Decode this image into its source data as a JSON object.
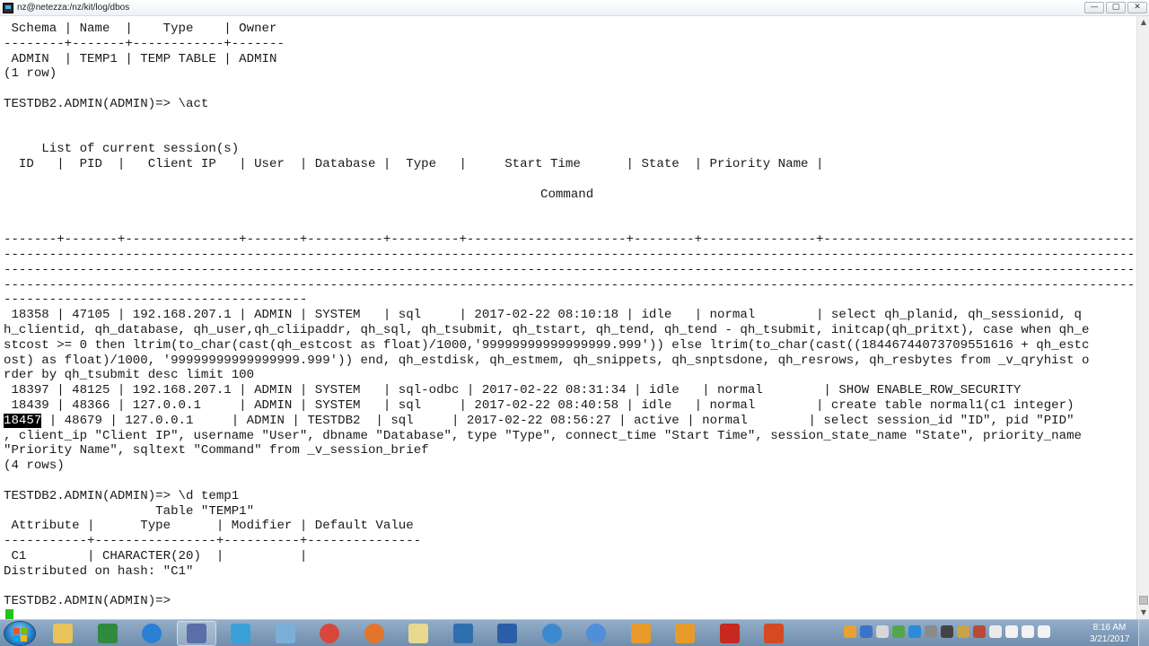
{
  "window": {
    "title": "nz@netezza:/nz/kit/log/dbos",
    "minimize": "—",
    "maximize": "▢",
    "close": "✕"
  },
  "terminal": {
    "lines": [
      " Schema | Name  |    Type    | Owner",
      "--------+-------+------------+-------",
      " ADMIN  | TEMP1 | TEMP TABLE | ADMIN",
      "(1 row)",
      "",
      "TESTDB2.ADMIN(ADMIN)=> \\act",
      "",
      "",
      "     List of current session(s)",
      "  ID   |  PID  |   Client IP   | User  | Database |  Type   |     Start Time      | State  | Priority Name |",
      "",
      "",
      "",
      "",
      "-------+-------+---------------+-------+----------+---------+---------------------+--------+---------------+------------------------------------------------------------------------------------------------------------",
      "----------------------------------------------------------------------------------------------------------------------------------------------------------------------------------------------------------------------",
      "----------------------------------------------------------------------------------------------------------------------------------------------------------------------------------------------------------------------",
      "----------------------------------------------------------------------------------------------------------------------------------------------------------------------------------------------------------------------",
      "----------------------------------------",
      " 18358 | 47105 | 192.168.207.1 | ADMIN | SYSTEM   | sql     | 2017-02-22 08:10:18 | idle   | normal        | select qh_planid, qh_sessionid, q",
      "h_clientid, qh_database, qh_user,qh_cliipaddr, qh_sql, qh_tsubmit, qh_tstart, qh_tend, qh_tend - qh_tsubmit, initcap(qh_pritxt), case when qh_e",
      "stcost >= 0 then ltrim(to_char(cast(qh_estcost as float)/1000,'99999999999999999.999')) else ltrim(to_char(cast((18446744073709551616 + qh_estc",
      "ost) as float)/1000, '99999999999999999.999')) end, qh_estdisk, qh_estmem, qh_snippets, qh_snptsdone, qh_resrows, qh_resbytes from _v_qryhist o",
      "rder by qh_tsubmit desc limit 100",
      " 18397 | 48125 | 192.168.207.1 | ADMIN | SYSTEM   | sql-odbc | 2017-02-22 08:31:34 | idle   | normal        | SHOW ENABLE_ROW_SECURITY",
      " 18439 | 48366 | 127.0.0.1     | ADMIN | SYSTEM   | sql     | 2017-02-22 08:40:58 | idle   | normal        | create table normal1(c1 integer)",
      "",
      ", client_ip \"Client IP\", username \"User\", dbname \"Database\", type \"Type\", connect_time \"Start Time\", session_state_name \"State\", priority_name",
      "\"Priority Name\", sqltext \"Command\" from _v_session_brief",
      "(4 rows)",
      "",
      "TESTDB2.ADMIN(ADMIN)=> \\d temp1",
      "                    Table \"TEMP1\"",
      " Attribute |      Type      | Modifier | Default Value",
      "-----------+----------------+----------+---------------",
      " C1        | CHARACTER(20)  |          |",
      "Distributed on hash: \"C1\"",
      "",
      "TESTDB2.ADMIN(ADMIN)=> "
    ],
    "command_header": "Command",
    "highlight_row": {
      "selected_id": "18457",
      "rest": " | 48679 | 127.0.0.1     | ADMIN | TESTDB2  | sql     | 2017-02-22 08:56:27 | active | normal        | select session_id \"ID\", pid \"PID\""
    }
  },
  "taskbar": {
    "clock_time": "8:16 AM",
    "clock_date": "3/21/2017",
    "items": [
      "explorer",
      "excel",
      "internet-explorer",
      "network",
      "media",
      "vm",
      "chrome",
      "firefox",
      "folder",
      "remote",
      "virtualbox",
      "q-app",
      "lifesaver",
      "flower",
      "flower",
      "pdf",
      "powerpoint"
    ]
  },
  "colors": {
    "cursor": "#22c21a",
    "taskbar": "#7f9bb9",
    "highlight_bg": "#000000"
  }
}
